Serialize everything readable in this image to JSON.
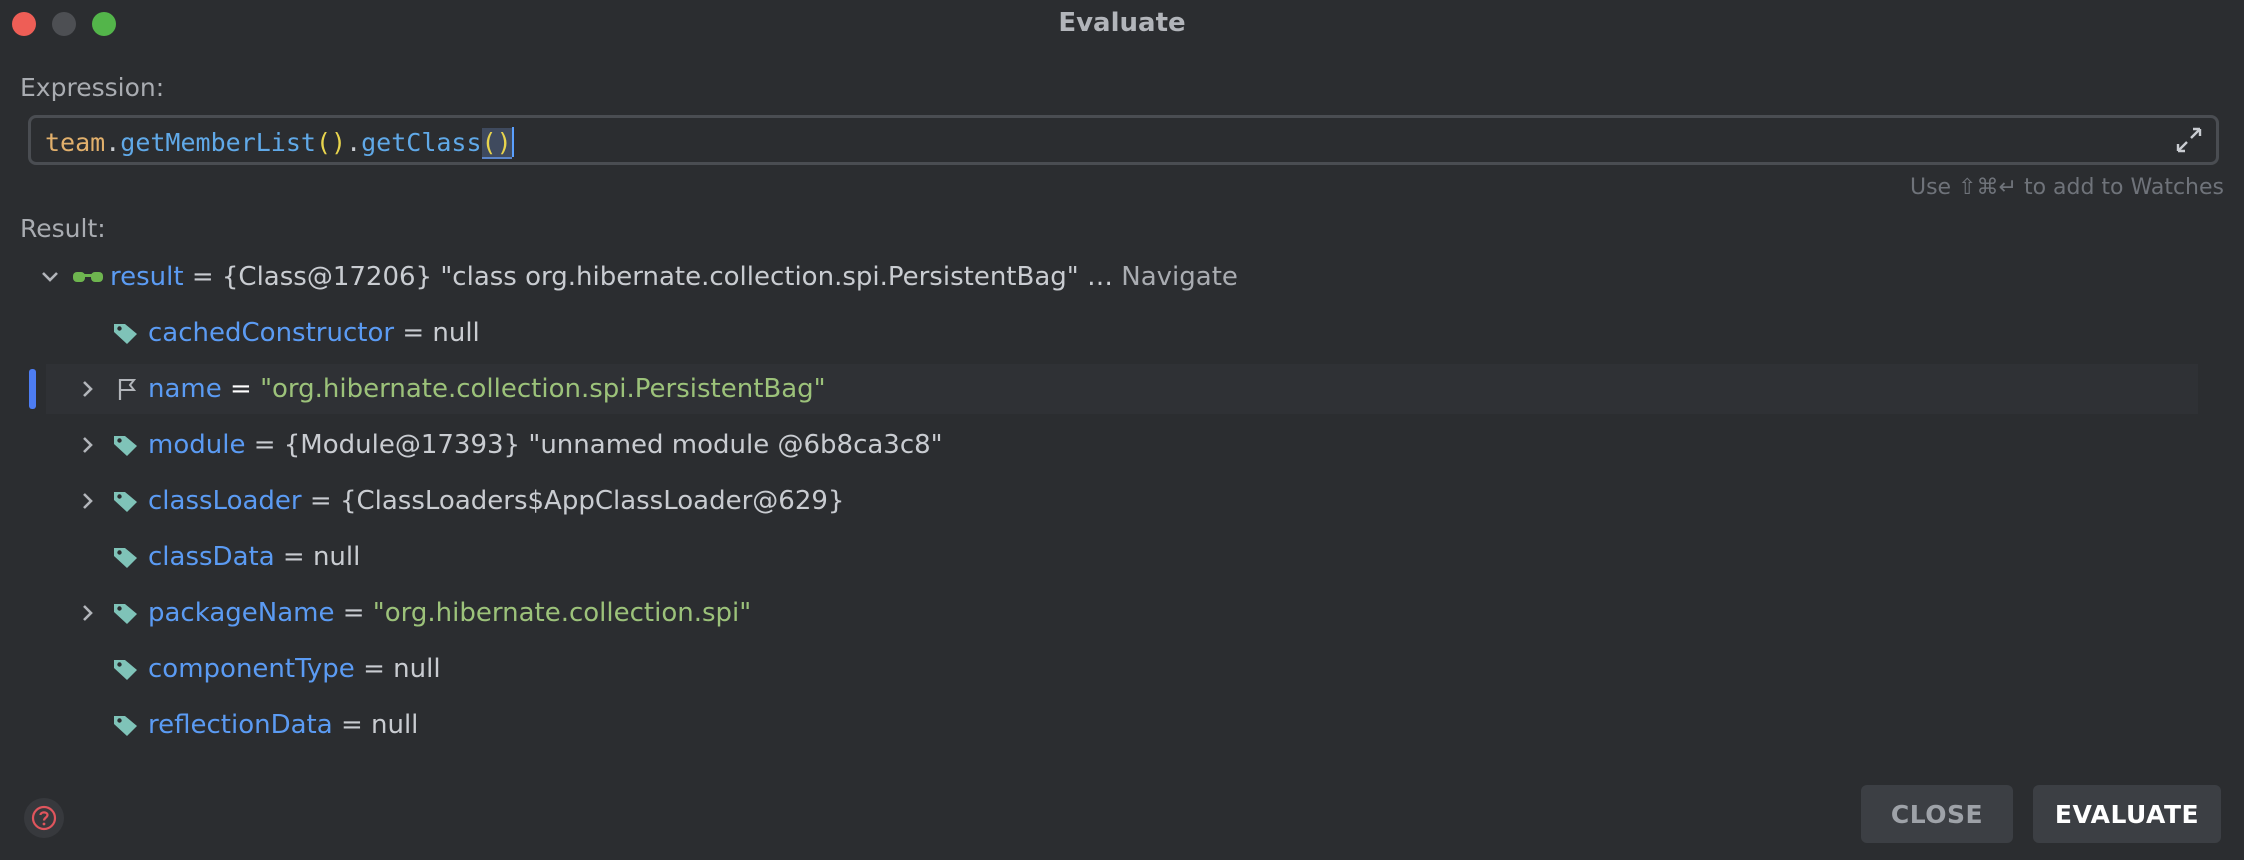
{
  "window": {
    "title": "Evaluate"
  },
  "expression": {
    "label": "Expression:",
    "tokens": {
      "var": "team",
      "dot1": ".",
      "fn1": "getMemberList",
      "p1": "()",
      "dot2": ".",
      "fn2": "getClass",
      "p2": "()"
    },
    "hint": "Use ⇧⌘↵ to add to Watches"
  },
  "result": {
    "label": "Result:",
    "root": {
      "name": "result",
      "eq": "=",
      "value": "{Class@17206} \"class org.hibernate.collection.spi.PersistentBag\" …",
      "navigate": "Navigate"
    },
    "fields": [
      {
        "name": "cachedConstructor",
        "eq": "=",
        "value": "null",
        "value_type": "plain",
        "expandable": false,
        "icon": "tag-icon"
      },
      {
        "name": "name",
        "eq": "=",
        "value": "\"org.hibernate.collection.spi.PersistentBag\"",
        "value_type": "string",
        "expandable": true,
        "icon": "flag-icon",
        "selected": true
      },
      {
        "name": "module",
        "eq": "=",
        "value": "{Module@17393} \"unnamed module @6b8ca3c8\"",
        "value_type": "plain",
        "expandable": true,
        "icon": "tag-icon"
      },
      {
        "name": "classLoader",
        "eq": "=",
        "value": "{ClassLoaders$AppClassLoader@629}",
        "value_type": "plain",
        "expandable": true,
        "icon": "tag-icon"
      },
      {
        "name": "classData",
        "eq": "=",
        "value": "null",
        "value_type": "plain",
        "expandable": false,
        "icon": "tag-icon"
      },
      {
        "name": "packageName",
        "eq": "=",
        "value": "\"org.hibernate.collection.spi\"",
        "value_type": "string",
        "expandable": true,
        "icon": "tag-icon"
      },
      {
        "name": "componentType",
        "eq": "=",
        "value": "null",
        "value_type": "plain",
        "expandable": false,
        "icon": "tag-icon"
      },
      {
        "name": "reflectionData",
        "eq": "=",
        "value": "null",
        "value_type": "plain",
        "expandable": false,
        "icon": "tag-icon"
      }
    ]
  },
  "buttons": {
    "close": "CLOSE",
    "evaluate": "EVALUATE"
  },
  "colors": {
    "background": "#2b2d30",
    "key": "#5b9bf3",
    "string": "#9cc27a",
    "accent": "#4d7df3"
  }
}
